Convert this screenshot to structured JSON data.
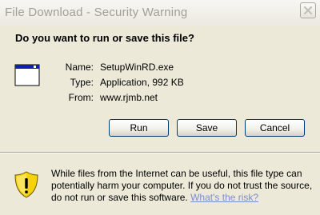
{
  "window": {
    "title": "File Download - Security Warning",
    "close_icon": "close-icon"
  },
  "dialog": {
    "question": "Do you want to run or save this file?",
    "file_icon": "application-window-icon",
    "fields": [
      {
        "label": "Name:",
        "value": "SetupWinRD.exe"
      },
      {
        "label": "Type:",
        "value": "Application, 992 KB"
      },
      {
        "label": "From:",
        "value": "www.rjmb.net"
      }
    ],
    "buttons": {
      "run": "Run",
      "save": "Save",
      "cancel": "Cancel"
    }
  },
  "warning": {
    "icon": "security-shield-warning-icon",
    "text": "While files from the Internet can be useful, this file type can potentially harm your computer. If you do not trust the source, do not run or save this software.",
    "link": "What's the risk?"
  },
  "colors": {
    "background": "#ece9d8",
    "title_text": "#a0a09a",
    "link": "#7a8fc7",
    "button_border": "#003c74",
    "shield_yellow": "#f5d20a"
  }
}
